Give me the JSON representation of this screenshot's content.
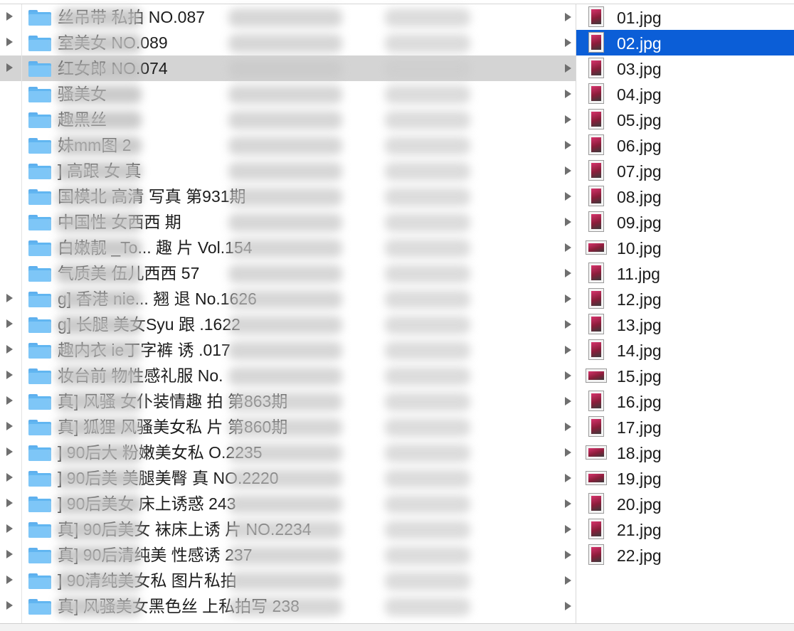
{
  "left_column": {
    "rows": [
      {
        "arrow": true
      },
      {
        "arrow": true
      },
      {
        "arrow": true,
        "selected": true
      },
      {
        "arrow": false
      },
      {
        "arrow": false
      },
      {
        "arrow": false
      },
      {
        "arrow": false
      },
      {
        "arrow": false
      },
      {
        "arrow": false
      },
      {
        "arrow": false
      },
      {
        "arrow": false
      },
      {
        "arrow": true
      },
      {
        "arrow": true
      },
      {
        "arrow": true
      },
      {
        "arrow": true
      },
      {
        "arrow": true
      },
      {
        "arrow": true
      },
      {
        "arrow": true
      },
      {
        "arrow": true
      },
      {
        "arrow": true
      },
      {
        "arrow": true
      },
      {
        "arrow": true
      },
      {
        "arrow": true
      },
      {
        "arrow": true
      }
    ]
  },
  "folders": [
    {
      "name": "丝吊带 私拍 NO.087",
      "selected": false
    },
    {
      "name": "室美女 NO.089",
      "selected": false
    },
    {
      "name": "红女郎 NO.074",
      "selected": true
    },
    {
      "name": "骚美女",
      "selected": false
    },
    {
      "name": "趣黑丝",
      "selected": false
    },
    {
      "name": "妹mm图 2",
      "selected": false
    },
    {
      "name": "] 高跟 女 真",
      "selected": false
    },
    {
      "name": "国模北 高清 写真 第931期",
      "selected": false
    },
    {
      "name": "中国性 女西西 期",
      "selected": false
    },
    {
      "name": "白嫩靓 _To... 趣 片 Vol.154",
      "selected": false
    },
    {
      "name": "气质美 伍儿西西 57",
      "selected": false
    },
    {
      "name": "g] 香港 nie... 翘 退 No.1626",
      "selected": false
    },
    {
      "name": "g] 长腿 美女Syu 跟 .1622",
      "selected": false
    },
    {
      "name": "趣内衣 ie丁字裤 诱 .017",
      "selected": false
    },
    {
      "name": "妆台前 物性感礼服 No.",
      "selected": false
    },
    {
      "name": "真] 风骚 女仆装情趣 拍 第863期",
      "selected": false
    },
    {
      "name": "真] 狐狸 风骚美女私 片 第860期",
      "selected": false
    },
    {
      "name": "] 90后大 粉嫩美女私 O.2235",
      "selected": false
    },
    {
      "name": "] 90后美 美腿美臀 真 NO.2220",
      "selected": false
    },
    {
      "name": "] 90后美女 床上诱惑 243",
      "selected": false
    },
    {
      "name": "真] 90后美女 袜床上诱 片 NO.2234",
      "selected": false
    },
    {
      "name": "真] 90后清纯美 性感诱 237",
      "selected": false
    },
    {
      "name": "] 90清纯美女私 图片私拍",
      "selected": false
    },
    {
      "name": "真] 风骚美女黑色丝 上私拍写 238",
      "selected": false
    }
  ],
  "files": [
    {
      "name": "01.jpg",
      "selected": false,
      "wide": false
    },
    {
      "name": "02.jpg",
      "selected": true,
      "wide": false
    },
    {
      "name": "03.jpg",
      "selected": false,
      "wide": false
    },
    {
      "name": "04.jpg",
      "selected": false,
      "wide": false
    },
    {
      "name": "05.jpg",
      "selected": false,
      "wide": false
    },
    {
      "name": "06.jpg",
      "selected": false,
      "wide": false
    },
    {
      "name": "07.jpg",
      "selected": false,
      "wide": false
    },
    {
      "name": "08.jpg",
      "selected": false,
      "wide": false
    },
    {
      "name": "09.jpg",
      "selected": false,
      "wide": false
    },
    {
      "name": "10.jpg",
      "selected": false,
      "wide": true
    },
    {
      "name": "11.jpg",
      "selected": false,
      "wide": false
    },
    {
      "name": "12.jpg",
      "selected": false,
      "wide": false
    },
    {
      "name": "13.jpg",
      "selected": false,
      "wide": false
    },
    {
      "name": "14.jpg",
      "selected": false,
      "wide": false
    },
    {
      "name": "15.jpg",
      "selected": false,
      "wide": true
    },
    {
      "name": "16.jpg",
      "selected": false,
      "wide": false
    },
    {
      "name": "17.jpg",
      "selected": false,
      "wide": false
    },
    {
      "name": "18.jpg",
      "selected": false,
      "wide": true
    },
    {
      "name": "19.jpg",
      "selected": false,
      "wide": true
    },
    {
      "name": "20.jpg",
      "selected": false,
      "wide": false
    },
    {
      "name": "21.jpg",
      "selected": false,
      "wide": false
    },
    {
      "name": "22.jpg",
      "selected": false,
      "wide": false
    }
  ],
  "colors": {
    "selection_active": "#0b5ed7",
    "selection_inactive": "#d4d4d4",
    "folder_blue": "#61b6f1"
  }
}
